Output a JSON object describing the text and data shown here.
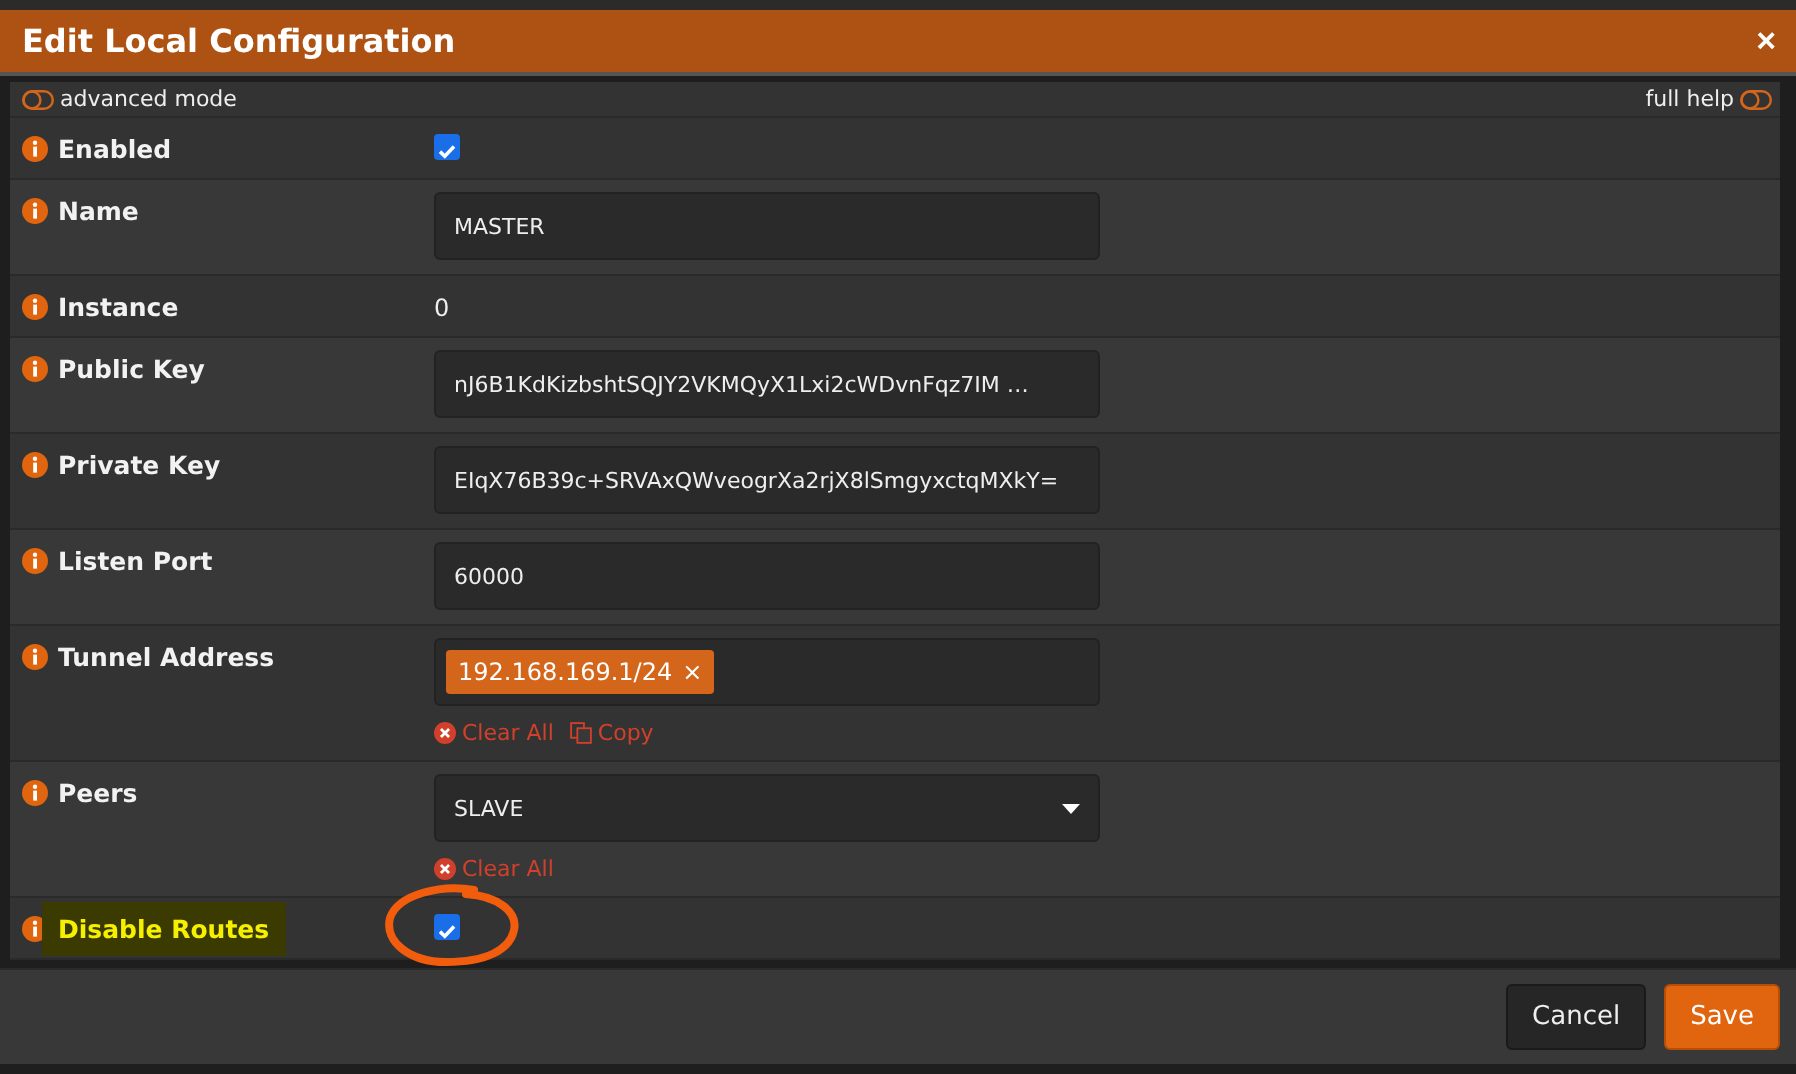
{
  "dialog": {
    "title": "Edit Local Configuration",
    "close": "×"
  },
  "header": {
    "advanced_mode": {
      "label": "advanced mode",
      "on": false
    },
    "full_help": {
      "label": "full help",
      "on": false
    }
  },
  "rows": [
    {
      "kind": "checkbox",
      "label": "Enabled",
      "checked": true,
      "highlighted": false,
      "circled": false
    },
    {
      "kind": "input",
      "label": "Name",
      "value": "MASTER"
    },
    {
      "kind": "static",
      "label": "Instance",
      "value": "0"
    },
    {
      "kind": "input",
      "label": "Public Key",
      "value": "nJ6B1KdKizbshtSQJY2VKMQyX1Lxi2cWDvnFqz7IM …"
    },
    {
      "kind": "input",
      "label": "Private Key",
      "value": "EIqX76B39c+SRVAxQWveogrXa2rjX8lSmgyxctqMXkY="
    },
    {
      "kind": "input",
      "label": "Listen Port",
      "value": "60000"
    },
    {
      "kind": "tokens",
      "label": "Tunnel Address",
      "tokens": [
        {
          "text": "192.168.169.1/24",
          "remove": "×"
        }
      ],
      "actions": [
        {
          "kind": "clear",
          "label": "Clear All"
        },
        {
          "kind": "copy",
          "label": "Copy"
        }
      ]
    },
    {
      "kind": "select",
      "label": "Peers",
      "value": "SLAVE",
      "actions": [
        {
          "kind": "clear",
          "label": "Clear All"
        }
      ]
    },
    {
      "kind": "checkbox",
      "label": "Disable Routes",
      "checked": true,
      "highlighted": true,
      "circled": true
    }
  ],
  "buttons": [
    {
      "kind": "secondary",
      "label": "Cancel"
    },
    {
      "kind": "primary",
      "label": "Save"
    }
  ]
}
